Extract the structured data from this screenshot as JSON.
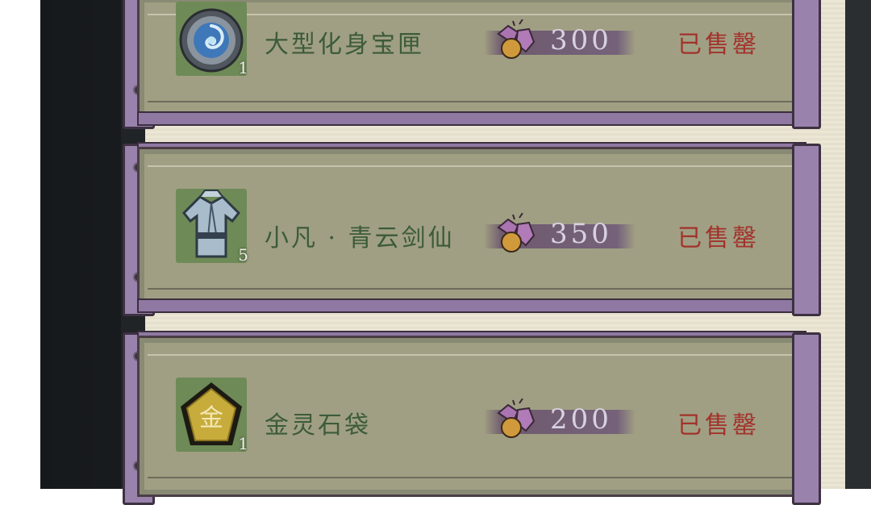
{
  "shop_items": [
    {
      "name": "大型化身宝匣",
      "quantity": "1",
      "price": "300",
      "status": "已售罄",
      "icon": "vortex-orb-icon"
    },
    {
      "name": "小凡 · 青云剑仙",
      "quantity": "5",
      "price": "350",
      "status": "已售罄",
      "icon": "robe-outfit-icon"
    },
    {
      "name": "金灵石袋",
      "quantity": "1",
      "price": "200",
      "status": "已售罄",
      "icon": "gold-stone-bag-icon"
    }
  ],
  "currency_icon": "spirit-gourd-currency-icon",
  "colors": {
    "board": "#a09f83",
    "frame_purple": "#9983ad",
    "name_green": "#3c5b3a",
    "sold_red": "#a2332c",
    "price_text": "#d8d1e0"
  }
}
